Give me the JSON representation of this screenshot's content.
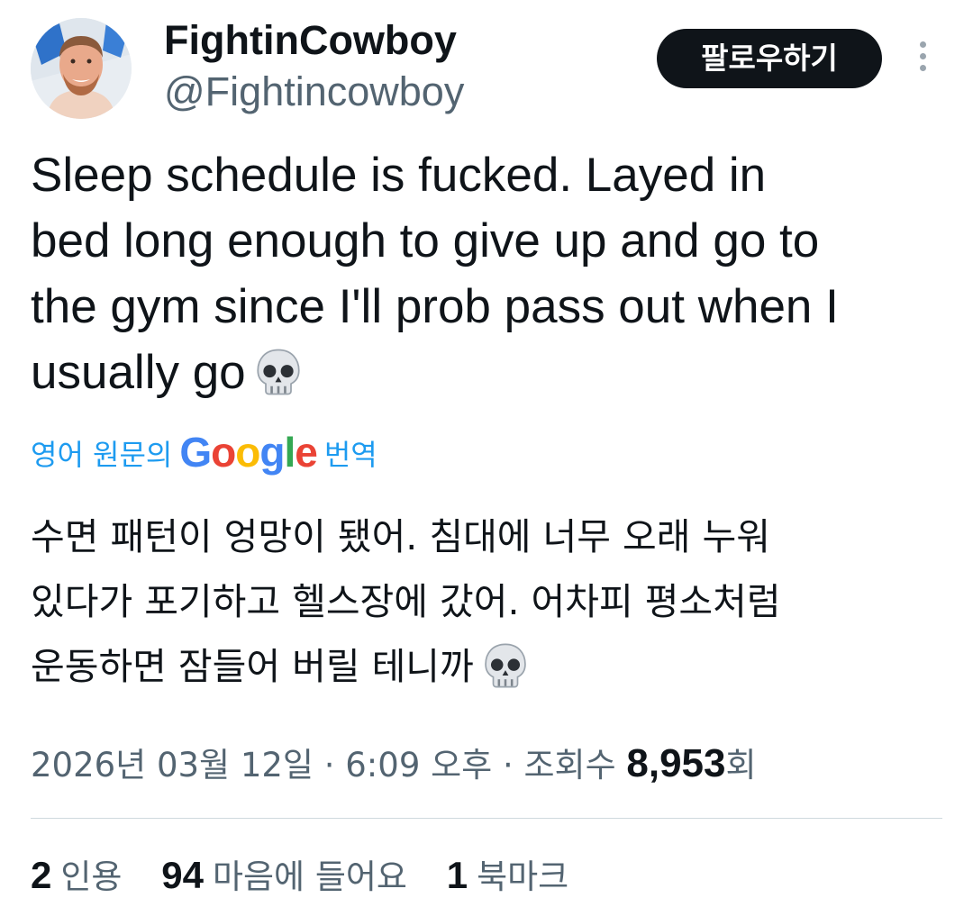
{
  "profile": {
    "display_name": "FightinCowboy",
    "handle": "@Fightincowboy",
    "avatar_icon": "profile-photo"
  },
  "actions": {
    "follow_label": "팔로우하기",
    "more_icon": "more-vertical-icon"
  },
  "tweet": {
    "lines": [
      "Sleep schedule is fucked. Layed in",
      "bed long enough to give up and go to",
      "the gym since I'll prob pass out when I",
      "usually go"
    ],
    "emoji": "skull-emoji"
  },
  "translation": {
    "prefix": "영어 원문의",
    "google_letters": [
      "G",
      "o",
      "o",
      "g",
      "l",
      "e"
    ],
    "suffix": "번역",
    "lines": [
      "수면 패턴이 엉망이 됐어. 침대에 너무 오래 누워",
      "있다가 포기하고 헬스장에 갔어. 어차피 평소처럼",
      "운동하면 잠들어 버릴 테니까"
    ]
  },
  "meta": {
    "date": "2026년 03월 12일",
    "separator": "·",
    "time": "6:09 오후",
    "views_label": "조회수",
    "views_count": "8,953",
    "views_suffix": "회"
  },
  "stats": {
    "quotes_count": "2",
    "quotes_label": "인용",
    "likes_count": "94",
    "likes_label": "마음에 들어요",
    "bookmarks_count": "1",
    "bookmarks_label": "북마크"
  },
  "colors": {
    "text": "#0f1419",
    "secondary": "#536471",
    "link": "#1d9bf0",
    "button_bg": "#0f1419",
    "divider": "#cfd9de"
  }
}
